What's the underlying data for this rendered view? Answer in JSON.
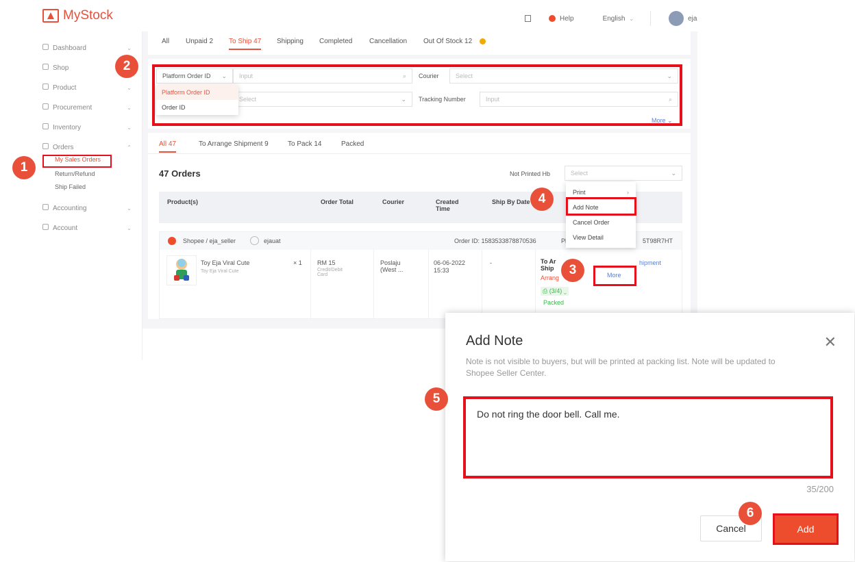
{
  "header": {
    "brand": "MyStock",
    "help": "Help",
    "language": "English",
    "user": "eja"
  },
  "sidebar": {
    "items": [
      {
        "label": "Dashboard"
      },
      {
        "label": "Shop"
      },
      {
        "label": "Product"
      },
      {
        "label": "Procurement"
      },
      {
        "label": "Inventory"
      },
      {
        "label": "Orders"
      },
      {
        "label": "Accounting"
      },
      {
        "label": "Account"
      }
    ],
    "orders_sub": [
      "My Sales Orders",
      "Return/Refund",
      "Ship Failed"
    ]
  },
  "status_tabs": [
    "All",
    "Unpaid 2",
    "To Ship 47",
    "Shipping",
    "Completed",
    "Cancellation",
    "Out Of Stock 12"
  ],
  "filters": {
    "order_id_type": "Platform Order ID",
    "input_placeholder": "Input",
    "courier_label": "Courier",
    "select_placeholder": "Select",
    "tracking_label": "Tracking Number",
    "more": "More",
    "dropdown_options": [
      "Platform Order ID",
      "Order ID"
    ]
  },
  "sub_tabs": [
    "All 47",
    "To Arrange Shipment 9",
    "To Pack 14",
    "Packed"
  ],
  "orders": {
    "count_title": "47 Orders",
    "not_printed_label": "Not Printed Hb",
    "select_placeholder": "Select",
    "columns": [
      "Product(s)",
      "Order Total",
      "Courier",
      "Created Time",
      "Ship By Date"
    ],
    "shop": "Shopee / eja_seller",
    "buyer": "ejauat",
    "order_id": "Order ID: 1583533878870536",
    "platform_partial": "Plat",
    "platform_id_partial": "5T98R7HT",
    "row": {
      "product": "Toy Eja Viral Cute",
      "product_sub": "Toy Eja Viral Cute",
      "qty": "× 1",
      "total": "RM 15",
      "payment": "Credit/Debit Card",
      "courier": "Poslaju (West ...",
      "created_date": "06-06-2022",
      "created_time": "15:33",
      "ship_by": "-",
      "status_partial": "To Ar Ship",
      "arrange_partial": "Arrang",
      "pack_progress": "(3/4)",
      "packed": "Packed",
      "shipment_partial": "hipment",
      "more": "More"
    }
  },
  "more_menu": [
    "Print",
    "Add Note",
    "Cancel Order",
    "View Detail"
  ],
  "modal": {
    "title": "Add Note",
    "description": "Note is not visible to buyers, but will be printed at packing list. Note will be updated to Shopee Seller Center.",
    "note_value": "Do not ring the door bell. Call me.",
    "counter": "35/200",
    "cancel": "Cancel",
    "add": "Add"
  },
  "steps": [
    "1",
    "2",
    "3",
    "4",
    "5",
    "6"
  ],
  "colors": {
    "accent": "#ee4d2d",
    "highlight": "#e6101b"
  }
}
